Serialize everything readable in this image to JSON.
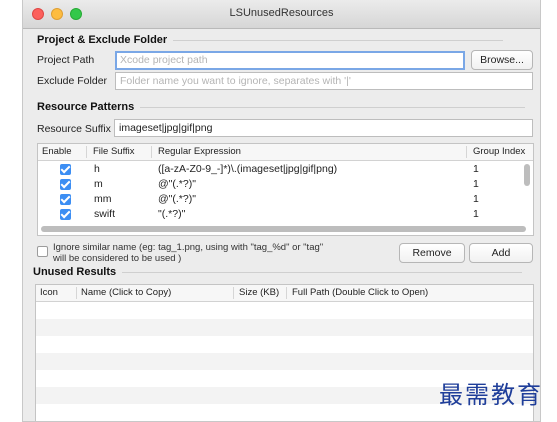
{
  "window": {
    "title": "LSUnusedResources"
  },
  "project_section": {
    "heading": "Project & Exclude Folder",
    "project_path_label": "Project Path",
    "project_path_placeholder": "Xcode project path",
    "browse_label": "Browse...",
    "exclude_label": "Exclude Folder",
    "exclude_placeholder": "Folder name you want to ignore, separates with '|'"
  },
  "patterns_section": {
    "heading": "Resource Patterns",
    "suffix_label": "Resource Suffix",
    "suffix_value": "imageset|jpg|gif|png",
    "columns": [
      "Enable",
      "File Suffix",
      "Regular Expression",
      "Group Index"
    ],
    "rows": [
      {
        "enabled": true,
        "suffix": "h",
        "regex": "([a-zA-Z0-9_-]*)\\.(imageset|jpg|gif|png)",
        "group": "1"
      },
      {
        "enabled": true,
        "suffix": "m",
        "regex": "@\"(.*?)\"",
        "group": "1"
      },
      {
        "enabled": true,
        "suffix": "mm",
        "regex": "@\"(.*?)\"",
        "group": "1"
      },
      {
        "enabled": true,
        "suffix": "swift",
        "regex": "\"(.*?)\"",
        "group": "1"
      }
    ],
    "ignore_similar_line1": "Ignore similar name (eg: tag_1.png, using with \"tag_%d\" or \"tag\"",
    "ignore_similar_line2": "will be considered to be used )",
    "remove_label": "Remove",
    "add_label": "Add"
  },
  "results_section": {
    "heading": "Unused Results",
    "columns": [
      "Icon",
      "Name (Click to Copy)",
      "Size (KB)",
      "Full Path (Double Click to Open)"
    ]
  },
  "watermark": "最需教育",
  "colors": {
    "accent": "#3c8ef3",
    "focus_ring": "#7aa7e6",
    "watermark": "#1f3e9a"
  }
}
